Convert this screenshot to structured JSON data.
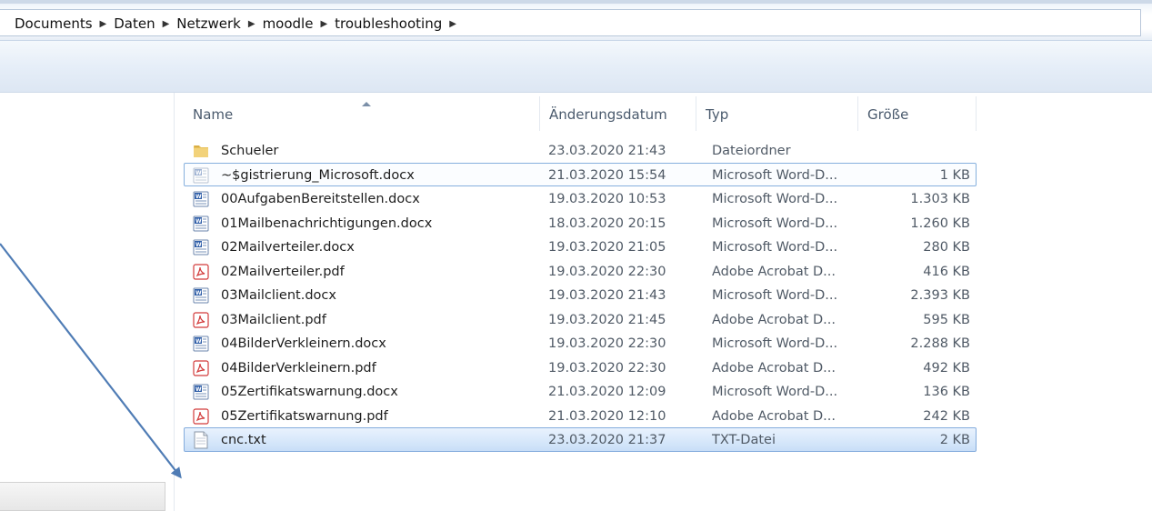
{
  "breadcrumb": [
    "Documents",
    "Daten",
    "Netzwerk",
    "moodle",
    "troubleshooting"
  ],
  "columns": {
    "name": "Name",
    "date": "Änderungsdatum",
    "type": "Typ",
    "size": "Größe"
  },
  "files": [
    {
      "name": "Schueler",
      "date": "23.03.2020 21:43",
      "type": "Dateiordner",
      "size": "",
      "icon": "folder-icon"
    },
    {
      "name": "~$gistrierung_Microsoft.docx",
      "date": "21.03.2020 15:54",
      "type": "Microsoft Word-D...",
      "size": "1 KB",
      "icon": "word-temp-icon"
    },
    {
      "name": "00AufgabenBereitstellen.docx",
      "date": "19.03.2020 10:53",
      "type": "Microsoft Word-D...",
      "size": "1.303 KB",
      "icon": "word-document-icon"
    },
    {
      "name": "01Mailbenachrichtigungen.docx",
      "date": "18.03.2020 20:15",
      "type": "Microsoft Word-D...",
      "size": "1.260 KB",
      "icon": "word-document-icon"
    },
    {
      "name": "02Mailverteiler.docx",
      "date": "19.03.2020 21:05",
      "type": "Microsoft Word-D...",
      "size": "280 KB",
      "icon": "word-document-icon"
    },
    {
      "name": "02Mailverteiler.pdf",
      "date": "19.03.2020 22:30",
      "type": "Adobe Acrobat D...",
      "size": "416 KB",
      "icon": "pdf-icon"
    },
    {
      "name": "03Mailclient.docx",
      "date": "19.03.2020 21:43",
      "type": "Microsoft Word-D...",
      "size": "2.393 KB",
      "icon": "word-document-icon"
    },
    {
      "name": "03Mailclient.pdf",
      "date": "19.03.2020 21:45",
      "type": "Adobe Acrobat D...",
      "size": "595 KB",
      "icon": "pdf-icon"
    },
    {
      "name": "04BilderVerkleinern.docx",
      "date": "19.03.2020 22:30",
      "type": "Microsoft Word-D...",
      "size": "2.288 KB",
      "icon": "word-document-icon"
    },
    {
      "name": "04BilderVerkleinern.pdf",
      "date": "19.03.2020 22:30",
      "type": "Adobe Acrobat D...",
      "size": "492 KB",
      "icon": "pdf-icon"
    },
    {
      "name": "05Zertifikatswarnung.docx",
      "date": "21.03.2020 12:09",
      "type": "Microsoft Word-D...",
      "size": "136 KB",
      "icon": "word-document-icon"
    },
    {
      "name": "05Zertifikatswarnung.pdf",
      "date": "21.03.2020 12:10",
      "type": "Adobe Acrobat D...",
      "size": "242 KB",
      "icon": "pdf-icon"
    },
    {
      "name": "cnc.txt",
      "date": "23.03.2020 21:37",
      "type": "TXT-Datei",
      "size": "2 KB",
      "icon": "text-file-icon"
    }
  ],
  "focused_file": "~$gistrierung_Microsoft.docx",
  "selected_file": "cnc.txt",
  "colors": {
    "accent": "#4a7ab8",
    "selection": "#cfe3fa",
    "arrow": "#4f7cb5"
  }
}
